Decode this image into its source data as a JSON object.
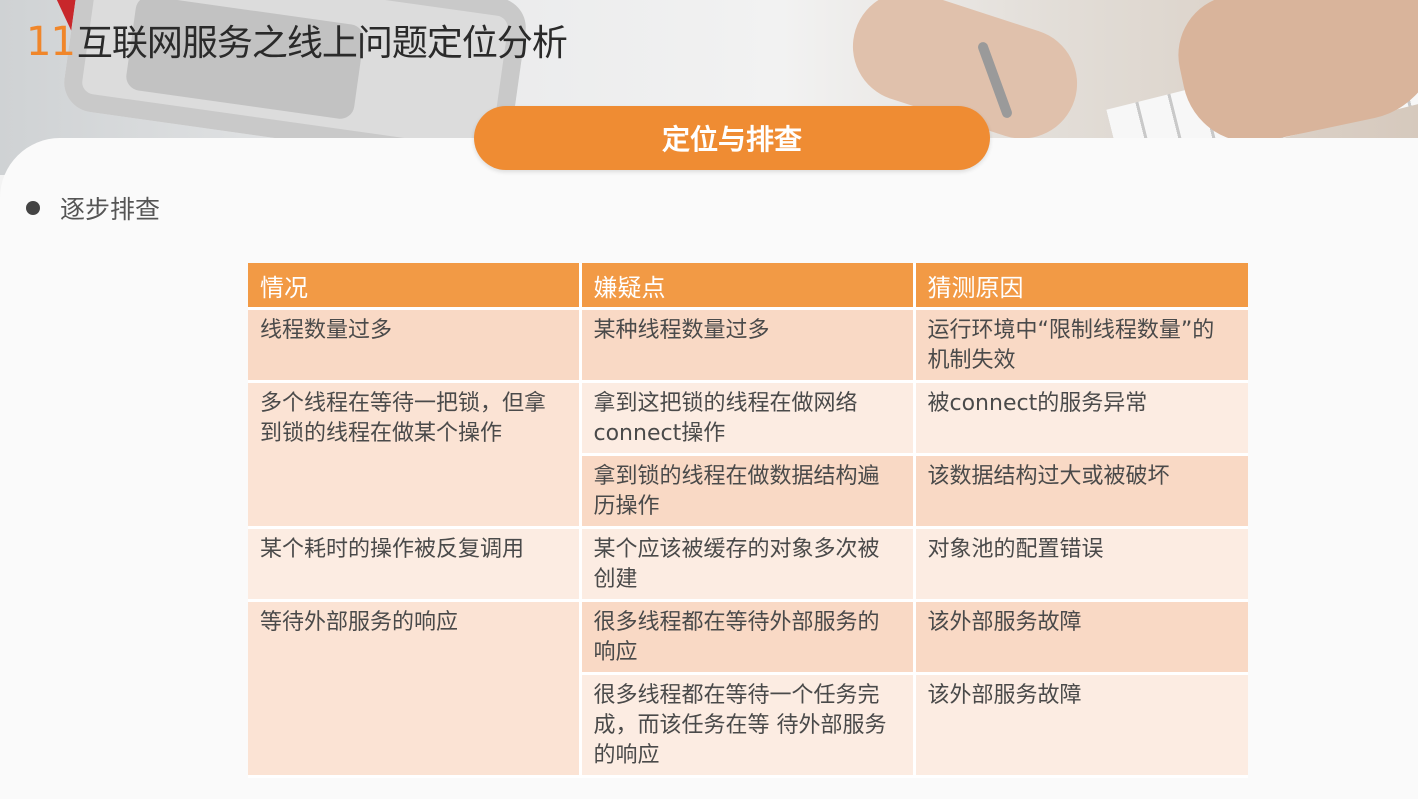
{
  "slide": {
    "number": "11",
    "title": "互联网服务之线上问题定位分析"
  },
  "section": {
    "title": "定位与排查"
  },
  "bullet": {
    "text": "逐步排查"
  },
  "table": {
    "headers": [
      "情况",
      "嫌疑点",
      "猜测原因"
    ],
    "rows": [
      {
        "situation": "线程数量过多",
        "suspect": "某种线程数量过多",
        "cause": "运行环境中“限制线程数量”的机制失效"
      },
      {
        "situation": "多个线程在等待一把锁，但拿到锁的线程在做某个操作",
        "suspect": "拿到这把锁的线程在做网络connect操作",
        "cause": "被connect的服务异常"
      },
      {
        "situation": "",
        "suspect": "拿到锁的线程在做数据结构遍历操作",
        "cause": "该数据结构过大或被破坏"
      },
      {
        "situation": "某个耗时的操作被反复调用",
        "suspect": "某个应该被缓存的对象多次被创建",
        "cause": "对象池的配置错误"
      },
      {
        "situation": "等待外部服务的响应",
        "suspect": "很多线程都在等待外部服务的响应",
        "cause": "该外部服务故障"
      },
      {
        "situation": "",
        "suspect": "很多线程都在等待一个任务完成，而该任务在等 待外部服务的响应",
        "cause": "该外部服务故障"
      }
    ]
  },
  "colors": {
    "accent": "#ef8c33",
    "header_bg": "#f29a45",
    "row_dark": "#f9d9c5",
    "row_light": "#fcece2"
  }
}
